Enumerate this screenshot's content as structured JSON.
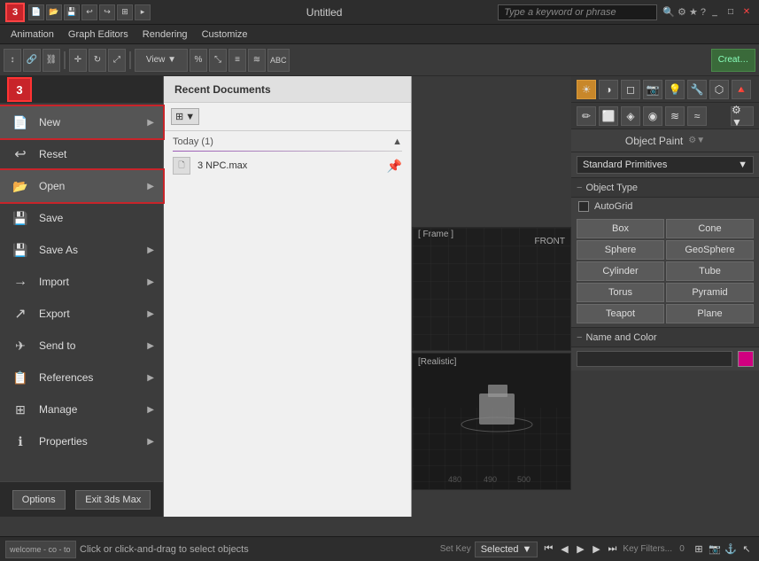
{
  "titleBar": {
    "title": "Untitled",
    "searchPlaceholder": "Type a keyword or phrase",
    "winBtns": [
      "_",
      "□",
      "×"
    ]
  },
  "menuBar": {
    "items": [
      "Animation",
      "Graph Editors",
      "Rendering",
      "Customize"
    ]
  },
  "appMenu": {
    "logoText": "3",
    "items": [
      {
        "id": "new",
        "label": "New",
        "icon": "📄",
        "hasArrow": true,
        "highlighted": true
      },
      {
        "id": "reset",
        "label": "Reset",
        "icon": "↩",
        "hasArrow": false
      },
      {
        "id": "open",
        "label": "Open",
        "icon": "📂",
        "hasArrow": true,
        "highlighted": true
      },
      {
        "id": "save",
        "label": "Save",
        "icon": "💾",
        "hasArrow": false
      },
      {
        "id": "save-as",
        "label": "Save As",
        "icon": "💾",
        "hasArrow": true
      },
      {
        "id": "import",
        "label": "Import",
        "icon": "→",
        "hasArrow": true
      },
      {
        "id": "export",
        "label": "Export",
        "icon": "↗",
        "hasArrow": true
      },
      {
        "id": "send-to",
        "label": "Send to",
        "icon": "✈",
        "hasArrow": true
      },
      {
        "id": "references",
        "label": "References",
        "icon": "📋",
        "hasArrow": true
      },
      {
        "id": "manage",
        "label": "Manage",
        "icon": "⊞",
        "hasArrow": true
      },
      {
        "id": "properties",
        "label": "Properties",
        "icon": "ℹ",
        "hasArrow": true
      }
    ]
  },
  "recentDocs": {
    "title": "Recent Documents",
    "todayLabel": "Today (1)",
    "items": [
      {
        "name": "3 NPC.max",
        "icon": "🗋"
      }
    ]
  },
  "rightPanel": {
    "objectPaintLabel": "Object Paint",
    "standardPrimitivesLabel": "Standard Primitives",
    "objectTypeLabel": "Object Type",
    "autoGridLabel": "AutoGrid",
    "objectButtons": [
      "Box",
      "Cone",
      "Sphere",
      "GeoSphere",
      "Cylinder",
      "Tube",
      "Torus",
      "Pyramid",
      "Teapot",
      "Plane"
    ],
    "nameAndColorLabel": "Name and Color",
    "colorValue": "#d00080"
  },
  "statusBar": {
    "welcomeText": "welcome - co - to",
    "statusText": "Click or click-and-drag to select objects",
    "setKeyLabel": "Set Key",
    "selectedLabel": "Selected",
    "keyFiltersLabel": "Key Filters...",
    "coordValue": "0"
  },
  "viewport": {
    "frontLabel": "FRONT",
    "realisticLabel": "[Realistic]",
    "gridNumbers": [
      "480",
      "490",
      "500"
    ]
  },
  "bottomButtons": {
    "optionsLabel": "Options",
    "exitLabel": "Exit 3ds Max"
  }
}
